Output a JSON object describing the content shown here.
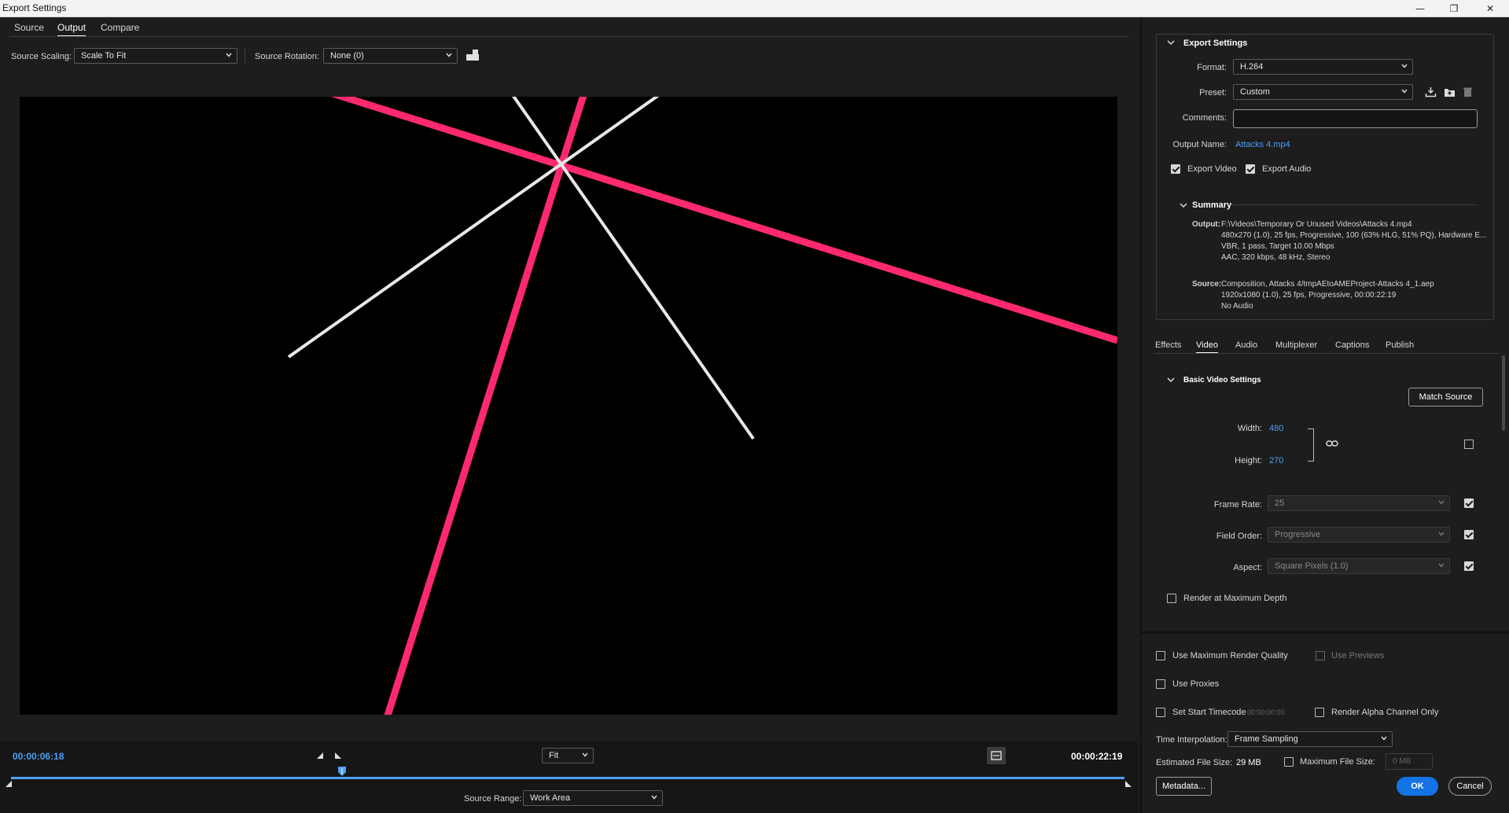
{
  "window": {
    "title": "Export Settings",
    "minimize_glyph": "—",
    "restore_glyph": "❐",
    "close_glyph": "✕"
  },
  "left": {
    "tabs": [
      "Source",
      "Output",
      "Compare"
    ],
    "active_tab": "Output",
    "source_scaling_label": "Source Scaling:",
    "source_scaling_value": "Scale To Fit",
    "source_rotation_label": "Source Rotation:",
    "source_rotation_value": "None (0)",
    "crop_icon": "crop-output-icon",
    "timeline": {
      "current_time": "00:00:06:18",
      "duration": "00:00:22:19",
      "zoom_value": "Fit",
      "source_range_label": "Source Range:",
      "source_range_value": "Work Area",
      "playhead_fraction": 0.297
    }
  },
  "right": {
    "export_settings_header": "Export Settings",
    "format_label": "Format:",
    "format_value": "H.264",
    "preset_label": "Preset:",
    "preset_value": "Custom",
    "comments_label": "Comments:",
    "comments_value": "",
    "output_name_label": "Output Name:",
    "output_name_value": "Attacks 4.mp4",
    "export_video_label": "Export Video",
    "export_audio_label": "Export Audio",
    "summary_header": "Summary",
    "summary_output_label": "Output:",
    "summary_output_lines": [
      "F:\\Videos\\Temporary Or Unused Videos\\Attacks 4.mp4",
      "480x270 (1.0), 25 fps, Progressive, 100 (63% HLG, 51% PQ), Hardware E...",
      "VBR, 1 pass, Target 10.00 Mbps",
      "AAC, 320 kbps, 48 kHz, Stereo"
    ],
    "summary_source_label": "Source:",
    "summary_source_lines": [
      "Composition, Attacks 4/tmpAEtoAMEProject-Attacks 4_1.aep",
      "1920x1080 (1.0), 25 fps, Progressive, 00:00:22:19",
      "No Audio"
    ],
    "tabs": [
      "Effects",
      "Video",
      "Audio",
      "Multiplexer",
      "Captions",
      "Publish"
    ],
    "active_tab": "Video",
    "basic_video_header": "Basic Video Settings",
    "match_source_label": "Match Source",
    "width_label": "Width:",
    "width_value": "480",
    "height_label": "Height:",
    "height_value": "270",
    "frame_rate_label": "Frame Rate:",
    "frame_rate_value": "25",
    "field_order_label": "Field Order:",
    "field_order_value": "Progressive",
    "aspect_label": "Aspect:",
    "aspect_value": "Square Pixels (1.0)",
    "render_max_depth_label": "Render at Maximum Depth",
    "use_max_render_quality_label": "Use Maximum Render Quality",
    "use_previews_label": "Use Previews",
    "use_proxies_label": "Use Proxies",
    "set_start_timecode_label": "Set Start Timecode",
    "start_timecode_value": "00:00:00:00",
    "render_alpha_label": "Render Alpha Channel Only",
    "time_interpolation_label": "Time Interpolation:",
    "time_interpolation_value": "Frame Sampling",
    "estimated_size_label": "Estimated File Size:",
    "estimated_size_value": "29 MB",
    "max_file_size_label": "Maximum File Size:",
    "max_file_size_value": "0 MB",
    "metadata_label": "Metadata...",
    "ok_label": "OK",
    "cancel_label": "Cancel"
  },
  "colors": {
    "accent": "#1473e6",
    "link": "#4f9ef5",
    "pink_line": "#ff2a6d",
    "white_line": "#e8e8e8"
  }
}
